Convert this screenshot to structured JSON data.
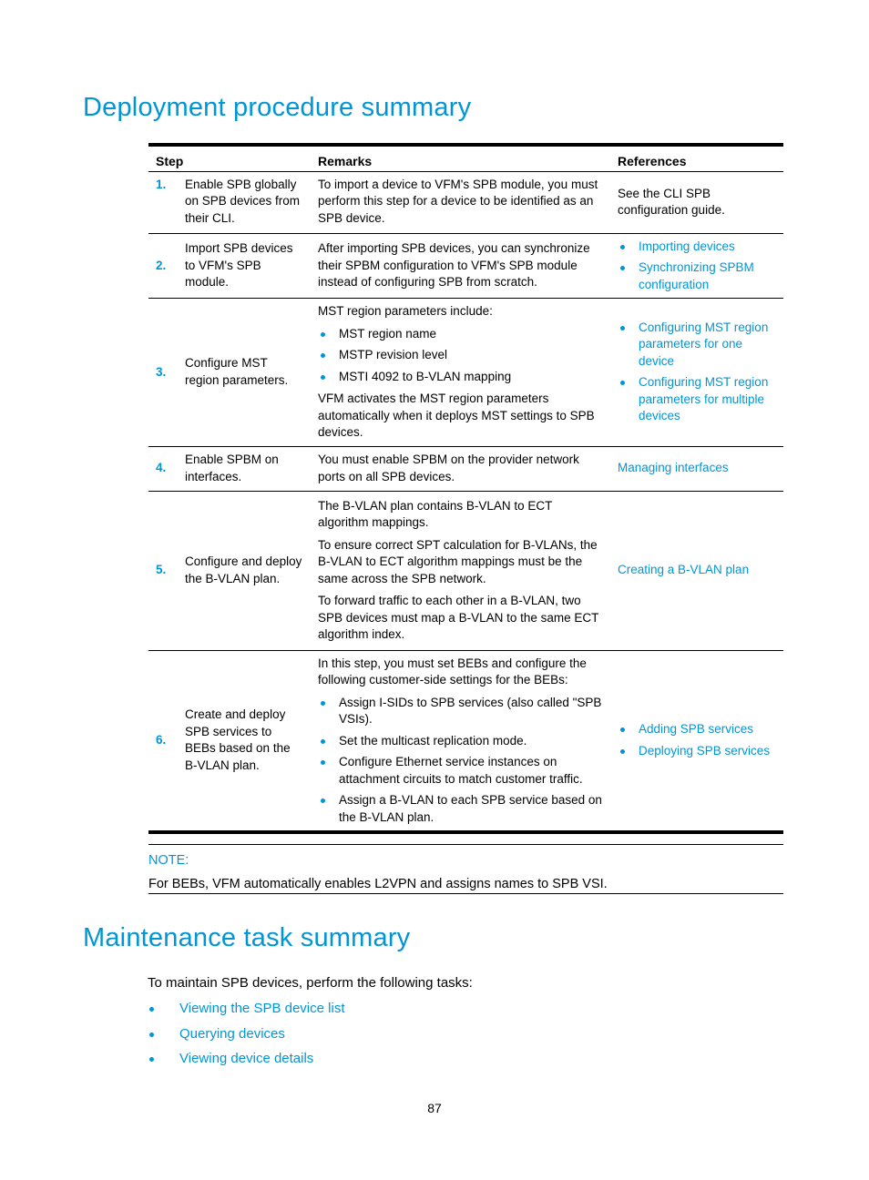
{
  "sections": {
    "deployment_title": "Deployment procedure summary",
    "maintenance_title": "Maintenance task summary"
  },
  "table": {
    "headers": {
      "step": "Step",
      "remarks": "Remarks",
      "references": "References"
    },
    "rows": [
      {
        "num": "1.",
        "step": "Enable SPB globally on SPB devices from their CLI.",
        "remarks_p1": "To import a device to VFM's SPB module, you must perform this step for a device to be identified as an SPB device.",
        "reference_text": "See the CLI SPB configuration guide."
      },
      {
        "num": "2.",
        "step": "Import SPB devices to VFM's SPB module.",
        "remarks_p1": "After importing SPB devices, you can synchronize their SPBM configuration to VFM's SPB module instead of configuring SPB from scratch.",
        "references": [
          "Importing devices",
          "Synchronizing SPBM configuration"
        ]
      },
      {
        "num": "3.",
        "step": "Configure MST region parameters.",
        "remarks_p1": "MST region parameters include:",
        "remarks_bullets": [
          "MST region name",
          "MSTP revision level",
          "MSTI 4092 to B-VLAN mapping"
        ],
        "remarks_p2": "VFM activates the MST region parameters automatically when it deploys MST settings to SPB devices.",
        "references": [
          "Configuring MST region parameters for one device",
          "Configuring MST region parameters for multiple devices"
        ]
      },
      {
        "num": "4.",
        "step": "Enable SPBM on interfaces.",
        "remarks_p1": "You must enable SPBM on the provider network ports on all SPB devices.",
        "reference_link": "Managing interfaces"
      },
      {
        "num": "5.",
        "step": "Configure and deploy the B-VLAN plan.",
        "remarks_p1": "The B-VLAN plan contains B-VLAN to ECT algorithm mappings.",
        "remarks_p2": "To ensure correct SPT calculation for B-VLANs, the B-VLAN to ECT algorithm mappings must be the same across the SPB network.",
        "remarks_p3": "To forward traffic to each other in a B-VLAN, two SPB devices must map a B-VLAN to the same ECT algorithm index.",
        "reference_link": "Creating a B-VLAN plan"
      },
      {
        "num": "6.",
        "step": "Create and deploy SPB services to BEBs based on the B-VLAN plan.",
        "remarks_p1": "In this step, you must set BEBs and configure the following customer-side settings for the BEBs:",
        "remarks_bullets": [
          "Assign I-SIDs to SPB services (also called \"SPB VSIs).",
          "Set the multicast replication mode.",
          "Configure Ethernet service instances on attachment circuits to match customer traffic.",
          "Assign a B-VLAN to each SPB service based on the B-VLAN plan."
        ],
        "references": [
          "Adding SPB services",
          "Deploying SPB services"
        ]
      }
    ]
  },
  "note": {
    "title": "NOTE:",
    "body": "For BEBs, VFM automatically enables L2VPN and assigns names to SPB VSI."
  },
  "maintenance": {
    "intro": "To maintain SPB devices, perform the following tasks:",
    "tasks": [
      "Viewing the SPB device list",
      "Querying devices",
      "Viewing device details"
    ]
  },
  "footer": {
    "page_number": "87"
  },
  "colors": {
    "accent": "#0096d6",
    "text": "#000000"
  }
}
